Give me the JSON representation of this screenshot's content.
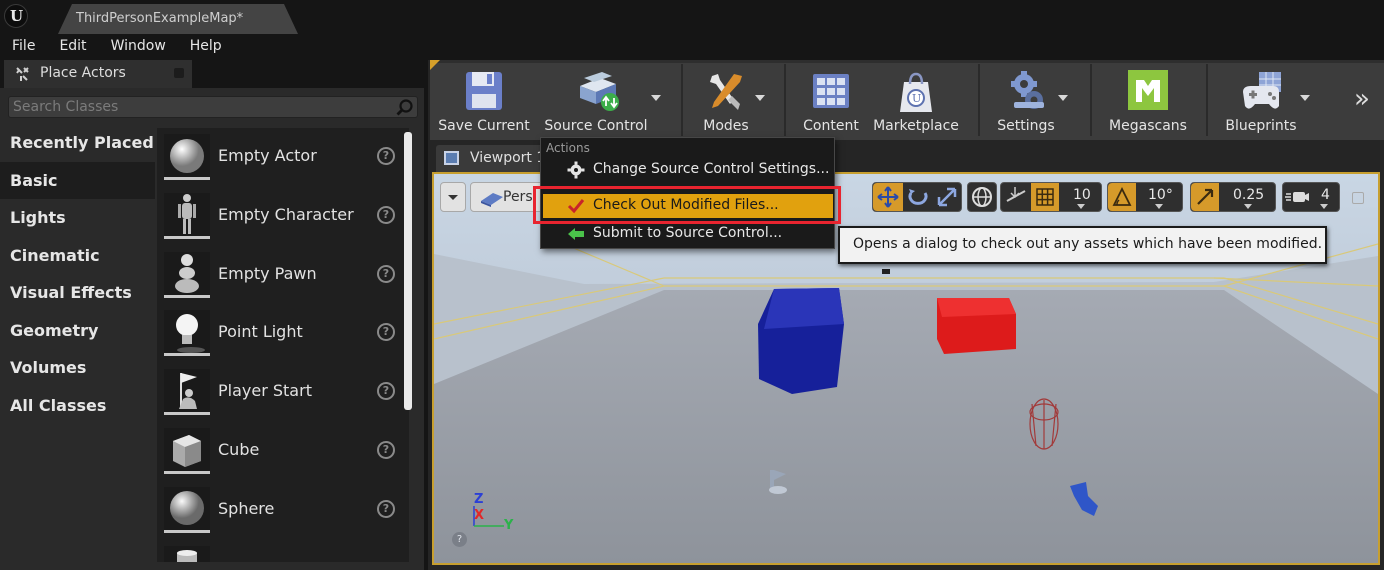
{
  "titlebar": {
    "doc_tab": "ThirdPersonExampleMap*"
  },
  "menu": [
    "File",
    "Edit",
    "Window",
    "Help"
  ],
  "place_actors": {
    "tab_label": "Place Actors",
    "search_placeholder": "Search Classes",
    "categories": [
      "Recently Placed",
      "Basic",
      "Lights",
      "Cinematic",
      "Visual Effects",
      "Geometry",
      "Volumes",
      "All Classes"
    ],
    "active_category": "Basic",
    "items": [
      "Empty Actor",
      "Empty Character",
      "Empty Pawn",
      "Point Light",
      "Player Start",
      "Cube",
      "Sphere"
    ]
  },
  "toolbar": {
    "save_current": "Save Current",
    "source_control": "Source Control",
    "modes": "Modes",
    "content": "Content",
    "marketplace": "Marketplace",
    "settings": "Settings",
    "megascans": "Megascans",
    "blueprints": "Blueprints"
  },
  "viewport": {
    "tab_label": "Viewport 1",
    "perspective_label": "Pers",
    "grid_snap": "10",
    "rotation_snap": "10°",
    "scale_snap": "0.25",
    "camera_speed": "4",
    "axis_z": "Z",
    "axis_x": "X",
    "axis_y": "Y"
  },
  "source_control_menu": {
    "heading": "Actions",
    "items": [
      {
        "label": "Change Source Control Settings..."
      },
      {
        "label": "Check Out Modified Files..."
      },
      {
        "label": "Submit to Source Control..."
      }
    ]
  },
  "tooltip": "Opens a dialog to check out any assets which have been modified.",
  "colors": {
    "accent": "#e1a10e",
    "highlight_box": "#e8242f",
    "viewport_border": "#c79f2f"
  }
}
